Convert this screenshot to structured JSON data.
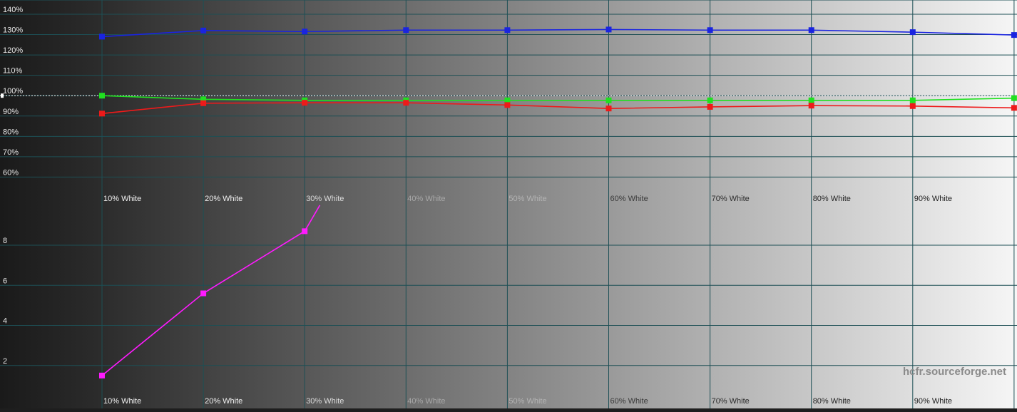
{
  "watermark": "hcfr.sourceforge.net",
  "chart_data": [
    {
      "type": "line",
      "panel": "rgb-levels",
      "categories": [
        "10% White",
        "20% White",
        "30% White",
        "40% White",
        "50% White",
        "60% White",
        "70% White",
        "80% White",
        "90% White"
      ],
      "x": [
        10,
        20,
        30,
        40,
        50,
        60,
        70,
        80,
        90,
        100
      ],
      "series": [
        {
          "color": "#1a24e0",
          "values": [
            129.0,
            132.0,
            131.5,
            132.2,
            132.2,
            132.5,
            132.2,
            132.2,
            131.2,
            129.8
          ]
        },
        {
          "color": "#20e020",
          "values": [
            100.0,
            98.2,
            97.7,
            97.7,
            97.7,
            97.7,
            97.7,
            97.7,
            97.7,
            98.8
          ]
        },
        {
          "color": "#ee1a1a",
          "values": [
            91.2,
            96.3,
            96.5,
            96.5,
            95.4,
            93.7,
            94.5,
            95.1,
            94.9,
            94.0
          ]
        }
      ],
      "reference": 100,
      "yticks": [
        "60%",
        "70%",
        "80%",
        "90%",
        "100%",
        "110%",
        "120%",
        "130%",
        "140%"
      ],
      "ylim": [
        57,
        147
      ],
      "grid": true
    },
    {
      "type": "line",
      "panel": "delta-e",
      "categories": [
        "10% White",
        "20% White",
        "30% White",
        "40% White",
        "50% White",
        "60% White",
        "70% White",
        "80% White",
        "90% White"
      ],
      "x": [
        10,
        20,
        30,
        31.5
      ],
      "series": [
        {
          "color": "#ff1aff",
          "values": [
            1.5,
            5.6,
            8.7,
            10.0
          ]
        }
      ],
      "yticks": [
        "2",
        "4",
        "6",
        "8"
      ],
      "ylim": [
        0,
        10.1
      ],
      "grid": true
    }
  ]
}
